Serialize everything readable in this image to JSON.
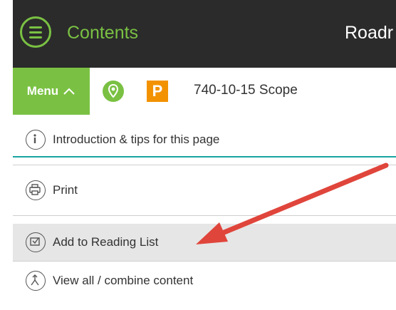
{
  "header": {
    "title": "Contents",
    "right_title_partial": "Roadr"
  },
  "nav": {
    "menu_label": "Menu",
    "section_code": "740-10-15 Scope",
    "parking_letter": "P"
  },
  "menu_items": [
    {
      "label": "Introduction & tips for this page",
      "icon": "info-icon"
    },
    {
      "label": "Print",
      "icon": "printer-icon"
    },
    {
      "label": "Add to Reading List",
      "icon": "add-to-list-icon"
    },
    {
      "label": "View all / combine content",
      "icon": "combine-icon"
    }
  ],
  "colors": {
    "brand_green": "#7ac143",
    "dark_header": "#2b2b2b",
    "parking_orange": "#f39200",
    "arrow_red": "#e0453b",
    "divider_teal": "#1aa3a3"
  }
}
